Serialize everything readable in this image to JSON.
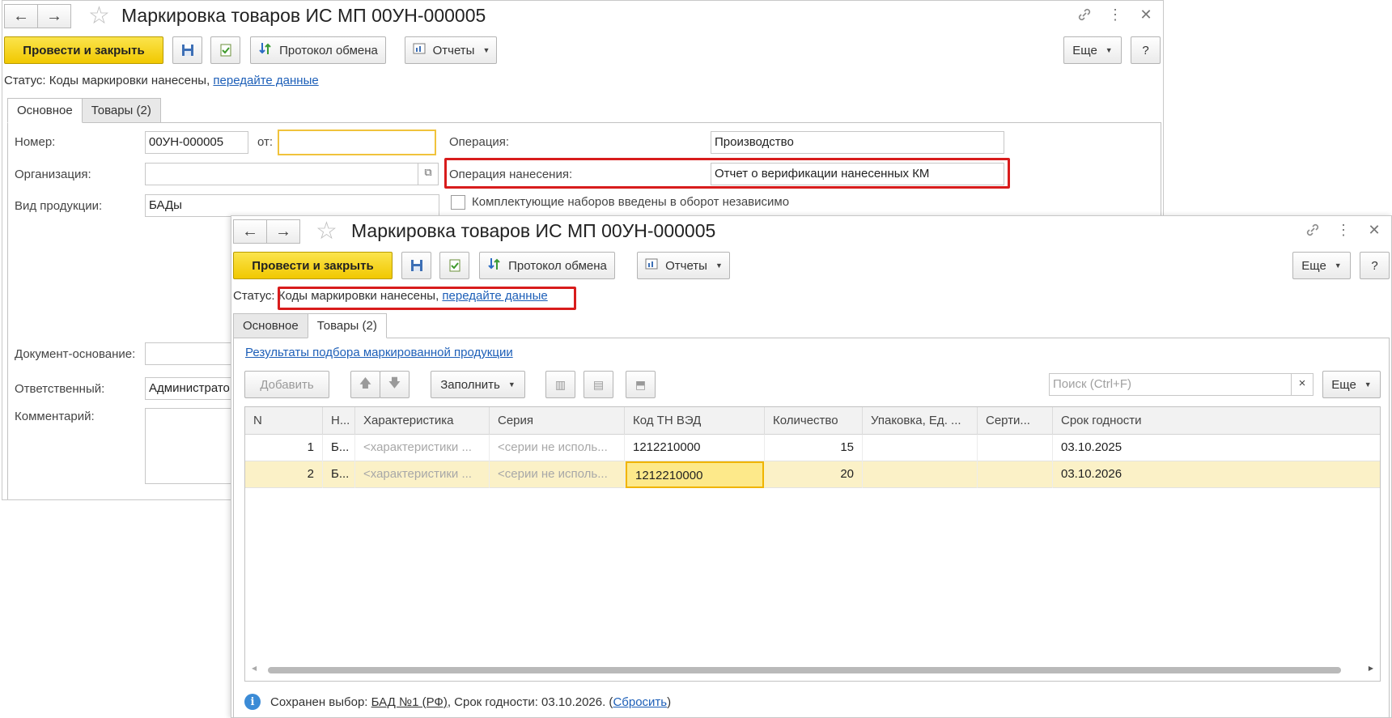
{
  "back_window": {
    "nav": {
      "back": "←",
      "forward": "→"
    },
    "title": "Маркировка товаров ИС МП 00УН-000005",
    "toolbar": {
      "post_close": "Провести и закрыть",
      "exchange_log": "Протокол обмена",
      "reports": "Отчеты",
      "more": "Еще",
      "help": "?"
    },
    "status": {
      "label": "Статус:",
      "text": "Коды маркировки нанесены,",
      "link": "передайте данные"
    },
    "tabs": [
      {
        "label": "Основное"
      },
      {
        "label": "Товары (2)"
      }
    ],
    "form": {
      "number_label": "Номер:",
      "number_value": "00УН-000005",
      "from_label": "от:",
      "from_value": "",
      "org_label": "Организация:",
      "org_value": "",
      "product_type_label": "Вид продукции:",
      "product_type_value": "БАДы",
      "operation_label": "Операция:",
      "operation_value": "Производство",
      "apply_operation_label": "Операция нанесения:",
      "apply_operation_value": "Отчет о верификации нанесенных КМ",
      "kit_checkbox_label": "Комплектующие наборов введены в оборот независимо",
      "basis_label": "Документ-основание:",
      "basis_value": "",
      "responsible_label": "Ответственный:",
      "responsible_value": "Администрато",
      "comment_label": "Комментарий:"
    }
  },
  "front_window": {
    "nav": {
      "back": "←",
      "forward": "→"
    },
    "title": "Маркировка товаров ИС МП 00УН-000005",
    "toolbar": {
      "post_close": "Провести и закрыть",
      "exchange_log": "Протокол обмена",
      "reports": "Отчеты",
      "more": "Еще",
      "help": "?"
    },
    "status": {
      "label": "Статус:",
      "text": "Коды маркировки нанесены,",
      "link": "передайте данные"
    },
    "tabs": [
      {
        "label": "Основное"
      },
      {
        "label": "Товары (2)"
      }
    ],
    "goods": {
      "results_link": "Результаты подбора маркированной продукции",
      "add": "Добавить",
      "fill": "Заполнить",
      "search_placeholder": "Поиск (Ctrl+F)",
      "search_clear": "×",
      "more": "Еще",
      "columns": [
        "N",
        "Н...",
        "Характеристика",
        "Серия",
        "Код ТН ВЭД",
        "Количество",
        "Упаковка, Ед. ...",
        "Серти...",
        "Срок годности"
      ],
      "rows": [
        {
          "n": "1",
          "name": "Б...",
          "char": "<характеристики ...",
          "series": "<серии не исполь...",
          "tnved": "1212210000",
          "qty": "15",
          "pack": "",
          "cert": "",
          "expiry": "03.10.2025"
        },
        {
          "n": "2",
          "name": "Б...",
          "char": "<характеристики ...",
          "series": "<серии не исполь...",
          "tnved": "1212210000",
          "qty": "20",
          "pack": "",
          "cert": "",
          "expiry": "03.10.2026"
        }
      ]
    },
    "footer": {
      "info_icon": "i",
      "prefix": "Сохранен выбор:",
      "item_link": "БАД №1 (РФ)",
      "mid": ", Срок годности: 03.10.2026. (",
      "reset_link": "Сбросить",
      "suffix": ")"
    }
  }
}
